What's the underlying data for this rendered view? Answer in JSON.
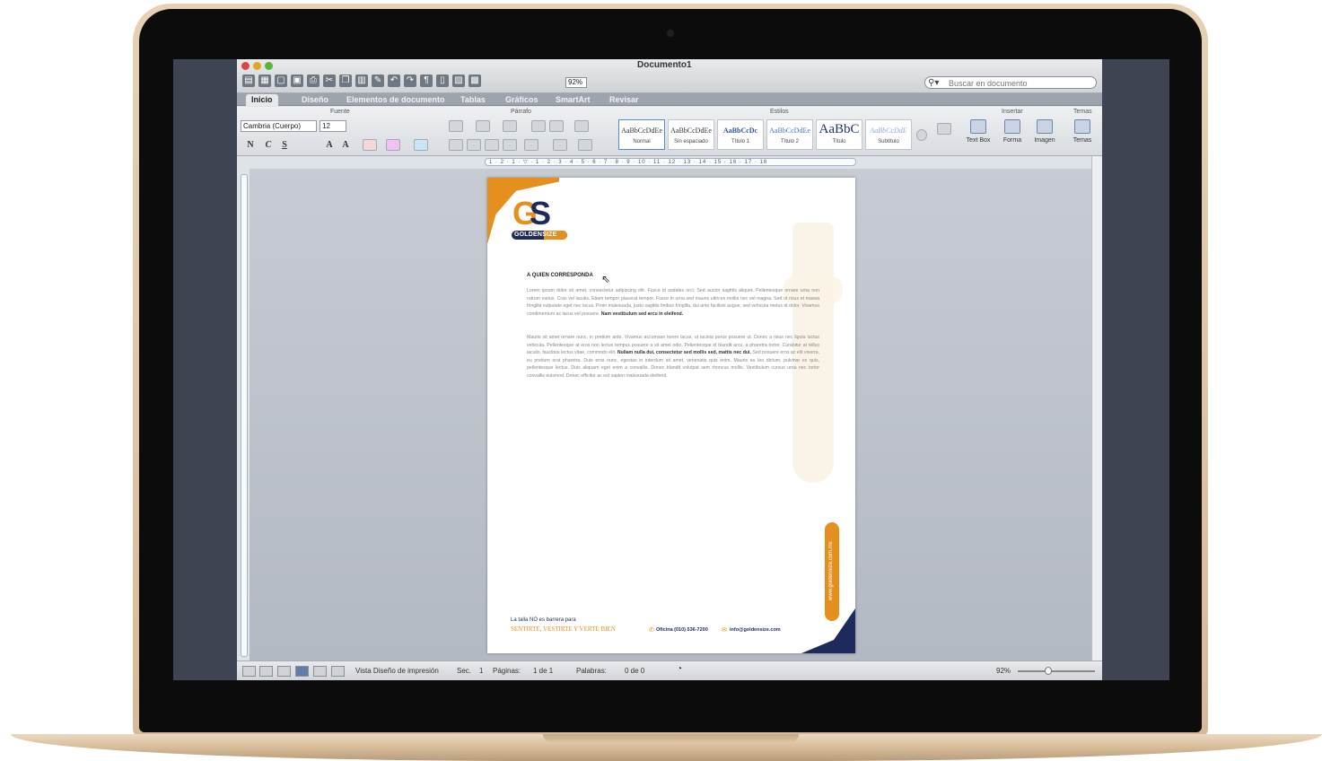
{
  "window": {
    "title": "Documento1",
    "zoom": "92%",
    "search_placeholder": "Buscar en documento"
  },
  "ribbon": {
    "tabs": [
      "Inicio",
      "Diseño",
      "Elementos de documento",
      "Tablas",
      "Gráficos",
      "SmartArt",
      "Revisar"
    ],
    "groups": [
      "Fuente",
      "Párrafo",
      "Estilos",
      "Insertar",
      "Temas"
    ],
    "font_name": "Cambria (Cuerpo)",
    "font_size": "12",
    "format_buttons": [
      "N",
      "C",
      "S",
      "A",
      "A"
    ],
    "styles": [
      {
        "sample": "AaBbCcDdEe",
        "name": "Normal"
      },
      {
        "sample": "AaBbCcDdEe",
        "name": "Sin espaciado"
      },
      {
        "sample": "AaBbCcDc",
        "name": "Título 1"
      },
      {
        "sample": "AaBbCcDdEe",
        "name": "Título 2"
      },
      {
        "sample": "AaBbC",
        "name": "Título"
      },
      {
        "sample": "AaBbCcDdE",
        "name": "Subtítulo"
      }
    ],
    "insert": [
      "Text Box",
      "Forma",
      "Imagen",
      "Temas"
    ]
  },
  "ruler": {
    "marks": "1 · 2 · 1 · ▽ · 1 · 2 · 3 · 4 · 5 · 6 · 7 · 8 · 9 · 10 · 11 · 12 · 13 · 14 · 15 · 16 · 17 · 18"
  },
  "document": {
    "logo_text": "GOLDENSIZE",
    "salutation": "A QUIEN CORRESPONDA",
    "paragraph1": "Lorem ipsum dolor sit amet, consectetur adipiscing elit. Fusce id sodales orci. Sed auctor sagittis aliquet. Pellentesque ornare urna non rutrum varius. Cras vel iaculis. Etiam tempor placerat tempor. Fusce in urna sed mauris ultrices mollis nec vel magna. Sed ut risus et massa fringilla vulputate eget nec lacus. Proin malesuada, justo sagittis finibus fringilla, dui ante facilisis augue, sed vehicula metus id dolor. Vivamus condimentum ac lacus vel posuere.",
    "paragraph1_bold": "Nam vestibulum sed arcu in eleifend.",
    "paragraph2_start": "Mauris sit amet ornare nunc, in pretium ante. Vivamus accumsan lorem lacus, ut lacinia purus posuere ut. Donec a risus nec ligula luctus vehicula. Pellentesque at eros non lectus tempus posuere a sit amet odio. Pellentesque id blandit arcu, a pharetra tortor. Curabitur at tellus iaculis, faucibus lectus vitae, commodo elit.",
    "paragraph2_bold": "Nullam nulla dui, consectetur sed mollis sed, mattis nec dui.",
    "paragraph2_end": "Sed posuere eros ac elit viverra, eu pretium erat pharetra. Duis eros nunc, egestas in interdum sit amet, venenatis quis enim. Mauris eu leo dictum, pulvinar ex quis, pellentesque lectus. Duis aliquam eget enim a convallis. Donec blandit volutpat sem rhoncus mollis. Vestibulum cursus urna nec tortor convallis euismod. Donec efficitur ac est sapien malesuada eleifend.",
    "side_url": "www.goldensize.com.mx",
    "tagline1": "La talla NO es barrera para",
    "tagline2": "SENTIRTE, VESTIRTE Y VERTE BIEN",
    "phone": "Oficina (010) 536-7200",
    "email": "info@goldensize.com"
  },
  "status": {
    "view": "Vista Diseño de impresión",
    "sec": "Sec.",
    "sec_val": "1",
    "pages": "Páginas:",
    "pages_val": "1 de 1",
    "words": "Palabras:",
    "words_val": "0 de 0",
    "zoom": "92%"
  },
  "colors": {
    "brand_orange": "#e58f1e",
    "brand_navy": "#1f2a5c"
  }
}
